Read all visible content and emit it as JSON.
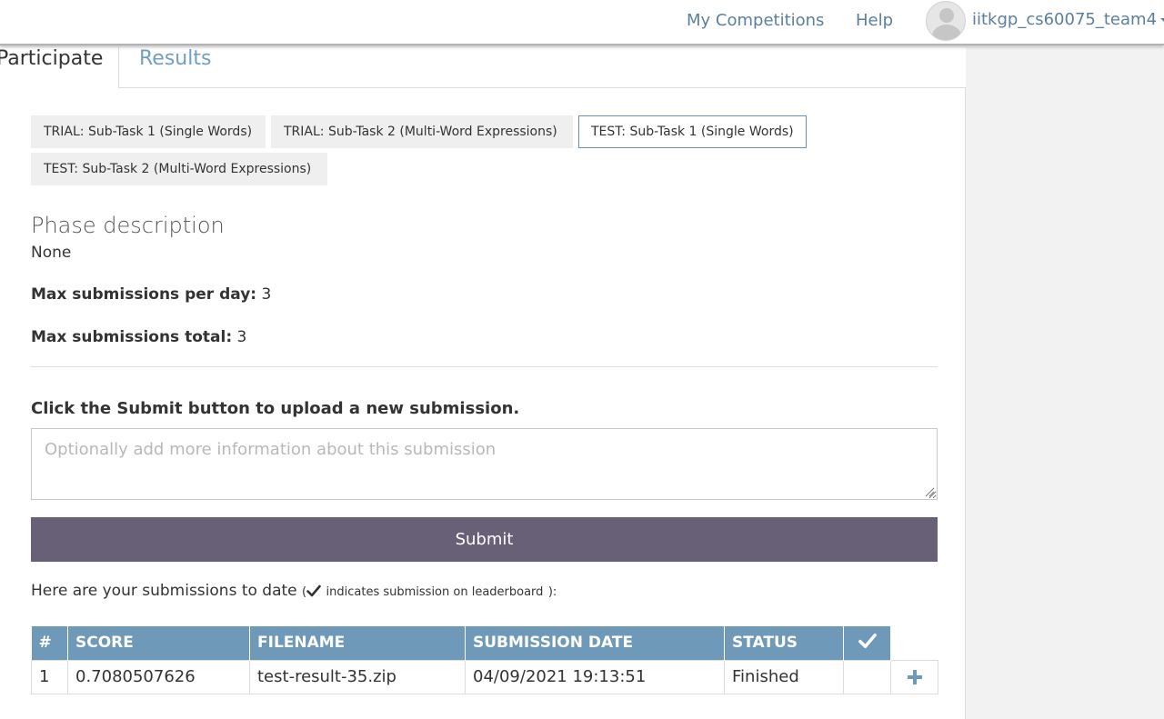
{
  "nav": {
    "my_competitions": "My Competitions",
    "help": "Help",
    "username": "iitkgp_cs60075_team4"
  },
  "tabs": {
    "participate": "Participate",
    "results": "Results"
  },
  "phases": [
    {
      "label": "TRIAL: Sub-Task 1 (Single Words)",
      "active": false
    },
    {
      "label": "TRIAL: Sub-Task 2 (Multi-Word Expressions)",
      "active": false
    },
    {
      "label": "TEST: Sub-Task 1 (Single Words)",
      "active": true
    },
    {
      "label": "TEST: Sub-Task 2 (Multi-Word Expressions)",
      "active": false
    }
  ],
  "phase_info": {
    "heading": "Phase description",
    "description": "None",
    "max_per_day_label": "Max submissions per day:",
    "max_per_day_value": "3",
    "max_total_label": "Max submissions total:",
    "max_total_value": "3"
  },
  "submission_form": {
    "instruction": "Click the Submit button to upload a new submission.",
    "notes_placeholder": "Optionally add more information about this submission",
    "notes_value": "",
    "submit_label": "Submit"
  },
  "submissions": {
    "intro_text": "Here are your submissions to date",
    "intro_note_open": "(",
    "intro_note": "indicates submission on leaderboard",
    "intro_note_close": "):",
    "headers": [
      "#",
      "SCORE",
      "FILENAME",
      "SUBMISSION DATE",
      "STATUS"
    ],
    "rows": [
      {
        "num": "1",
        "score": "0.7080507626",
        "filename": "test-result-35.zip",
        "date": "04/09/2021 19:13:51",
        "status": "Finished"
      }
    ]
  },
  "colors": {
    "accent_link": "#5b7fa0",
    "table_header": "#6e99b8",
    "submit_button": "#686077",
    "plus_icon": "#6e99b8"
  },
  "icons": {
    "leaderboard_check": "check-icon",
    "add": "plus-icon",
    "user_menu": "caret-down-icon"
  }
}
